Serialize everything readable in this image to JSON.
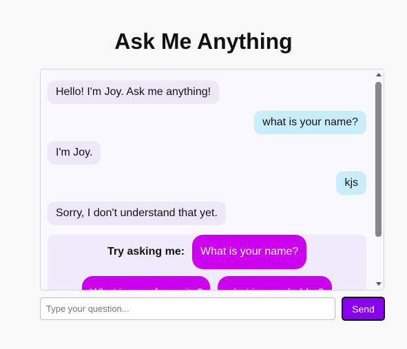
{
  "header": {
    "title": "Ask Me Anything"
  },
  "chat": {
    "messages": [
      {
        "sender": "bot",
        "text": "Hello! I'm Joy. Ask me anything!"
      },
      {
        "sender": "user",
        "text": "what is your name?"
      },
      {
        "sender": "bot",
        "text": "I'm Joy."
      },
      {
        "sender": "user",
        "text": "kjs"
      },
      {
        "sender": "bot",
        "text": "Sorry, I don't understand that yet."
      }
    ],
    "suggestions": {
      "label": "Try asking me:",
      "items": [
        "What is your name?",
        "What is your favourite?",
        "what is your hobby?"
      ]
    }
  },
  "composer": {
    "placeholder": "Type your question...",
    "value": "",
    "send_label": "Send"
  },
  "colors": {
    "accent": "#8800f0",
    "chip": "#cc00ee",
    "bot_bubble": "#ece8f8",
    "user_bubble": "#c8eefc"
  }
}
